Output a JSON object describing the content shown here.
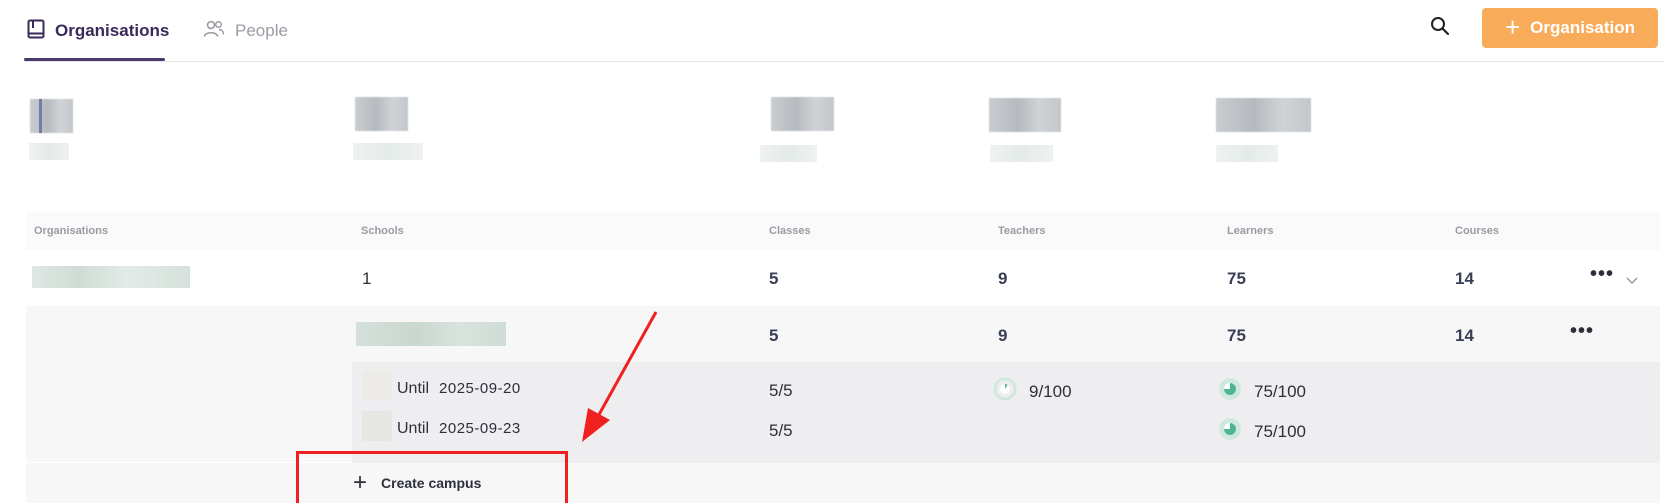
{
  "nav": {
    "tabs": [
      {
        "label": "Organisations",
        "icon": "book-icon",
        "active": true
      },
      {
        "label": "People",
        "icon": "people-icon",
        "active": false
      }
    ],
    "add_button_label": "Organisation",
    "accent_color": "#f8ac5a",
    "active_tab_color": "#4b3a6e"
  },
  "table": {
    "headers": [
      "Organisations",
      "Schools",
      "Classes",
      "Teachers",
      "Learners",
      "Courses"
    ],
    "org_row": {
      "schools": "1",
      "classes": "5",
      "teachers": "9",
      "learners": "75",
      "courses": "14"
    },
    "school_row": {
      "classes": "5",
      "teachers": "9",
      "learners": "75",
      "courses": "14"
    },
    "campuses": [
      {
        "until_label": "Until",
        "date": "2025-09-20",
        "classes": "5/5",
        "teachers": "9/100",
        "teachers_fraction": 0.09,
        "learners": "75/100",
        "learners_fraction": 0.75
      },
      {
        "until_label": "Until",
        "date": "2025-09-23",
        "classes": "5/5",
        "teachers": "",
        "learners": "75/100",
        "learners_fraction": 0.75
      }
    ],
    "create_campus_label": "Create campus"
  },
  "annotation_color": "#f02020"
}
